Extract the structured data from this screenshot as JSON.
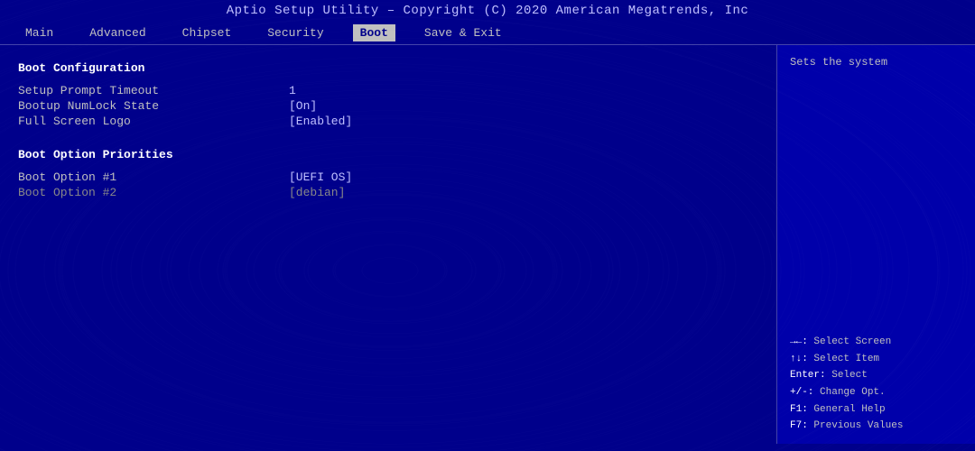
{
  "title_bar": {
    "text": "Aptio Setup Utility – Copyright (C) 2020 American Megatrends, Inc"
  },
  "nav": {
    "items": [
      {
        "label": "Main",
        "active": false
      },
      {
        "label": "Advanced",
        "active": false
      },
      {
        "label": "Chipset",
        "active": false
      },
      {
        "label": "Security",
        "active": false
      },
      {
        "label": "Boot",
        "active": true
      },
      {
        "label": "Save & Exit",
        "active": false
      }
    ]
  },
  "boot_config": {
    "section_header": "Boot Configuration",
    "rows": [
      {
        "label": "Setup Prompt Timeout",
        "value": "1"
      },
      {
        "label": "Bootup NumLock State",
        "value": "[On]"
      },
      {
        "label": "Full Screen Logo",
        "value": "[Enabled]"
      }
    ]
  },
  "boot_priorities": {
    "section_header": "Boot Option Priorities",
    "rows": [
      {
        "label": "Boot Option #1",
        "value": "[UEFI OS]",
        "dimmed": false
      },
      {
        "label": "Boot Option #2",
        "value": "[debian]",
        "dimmed": true
      }
    ]
  },
  "help": {
    "text": "Sets the system"
  },
  "shortcuts": [
    {
      "key": "→←:",
      "desc": "Select Screen"
    },
    {
      "key": "↑↓:",
      "desc": "Select Item"
    },
    {
      "key": "Enter:",
      "desc": "Select"
    },
    {
      "key": "+/-:",
      "desc": "Change Opt."
    },
    {
      "key": "F1:",
      "desc": "General Help"
    },
    {
      "key": "F7:",
      "desc": "Previous Values"
    }
  ]
}
